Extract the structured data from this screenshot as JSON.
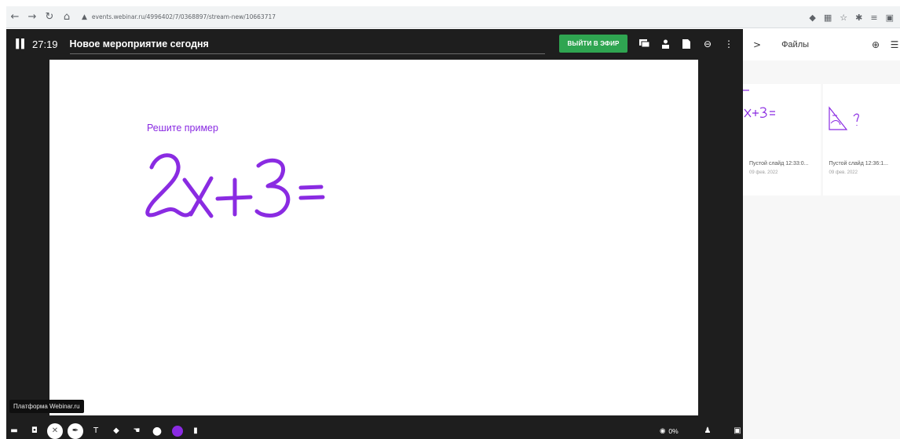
{
  "browser": {
    "url": "events.webinar.ru/4996402/7/0368897/stream-new/10663717",
    "nav_back": "←",
    "nav_forward": "→",
    "reload": "C",
    "home": "⌂",
    "lock": "🔒"
  },
  "app": {
    "timer": "27:19",
    "event_title": "Новое мероприятие сегодня",
    "live_button": "ВЫЙТИ В ЭФИР",
    "icons": [
      "chat-icon",
      "person-icon",
      "file-icon",
      "link-icon",
      "more-vert-icon"
    ]
  },
  "slide": {
    "caption": "Решите пример",
    "handwritten": "2x+3 =",
    "ink_color": "#8a2be2"
  },
  "tooltip": {
    "text": "Платформа Webinar.ru"
  },
  "toolbar": {
    "text_tool": "T",
    "color": "#8a2be2",
    "zoom": "0%"
  },
  "panel": {
    "title": "Файлы",
    "chevron": ">",
    "cards": [
      {
        "title": "Пустой слайд 12:33:0...",
        "date": "09 фев. 2022",
        "thumb_text": "x+3 ="
      },
      {
        "title": "Пустой слайд 12:36:1...",
        "date": "09 фев. 2022",
        "thumb_text": "?"
      }
    ]
  },
  "colors": {
    "accent_green": "#2fa551",
    "dark_bg": "#1e1e1e",
    "ink_purple": "#8a2be2"
  }
}
